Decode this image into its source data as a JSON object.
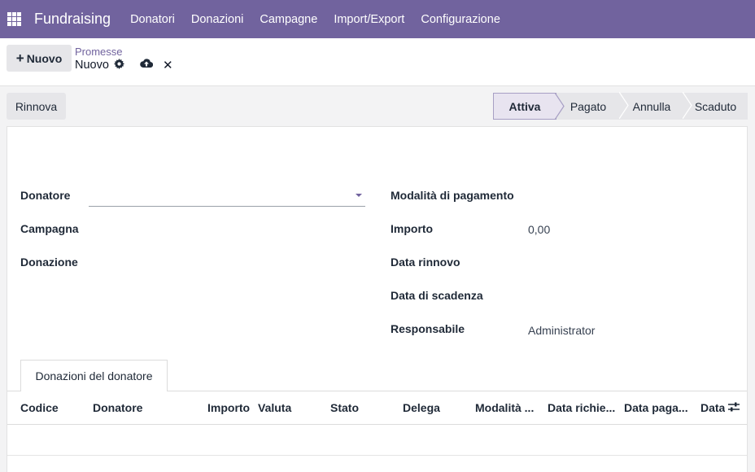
{
  "navbar": {
    "apps_icon": "apps-grid-icon",
    "brand": "Fundraising",
    "menu": [
      "Donatori",
      "Donazioni",
      "Campagne",
      "Import/Export",
      "Configurazione"
    ]
  },
  "control_panel": {
    "new_label": "Nuovo",
    "breadcrumb": "Promesse",
    "record_name": "Nuovo",
    "icons": [
      "gear-icon",
      "cloud-upload-icon",
      "close-icon"
    ]
  },
  "header": {
    "renew_label": "Rinnova",
    "stages": [
      "Attiva",
      "Pagato",
      "Annulla",
      "Scaduto"
    ],
    "active_stage": "Attiva"
  },
  "form": {
    "left": [
      {
        "label": "Donatore",
        "value": ""
      },
      {
        "label": "Campagna",
        "value": ""
      },
      {
        "label": "Donazione",
        "value": ""
      }
    ],
    "right": [
      {
        "label": "Modalità di pagamento",
        "value": ""
      },
      {
        "label": "Importo",
        "value": "0,00"
      },
      {
        "label": "Data rinnovo",
        "value": ""
      },
      {
        "label": "Data di scadenza",
        "value": ""
      },
      {
        "label": "Responsabile",
        "value": "Administrator"
      }
    ]
  },
  "tabs": [
    {
      "label": "Donazioni del donatore"
    }
  ],
  "list": {
    "columns": [
      "Codice",
      "Donatore",
      "Importo",
      "Valuta",
      "Stato",
      "Delega",
      "Modalità ...",
      "Data richie...",
      "Data paga...",
      "Data"
    ]
  },
  "colors": {
    "brand": "#71639e",
    "active_stage_bg": "#e8e4f0"
  }
}
